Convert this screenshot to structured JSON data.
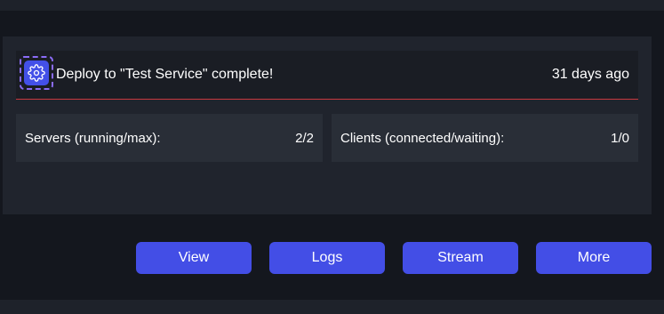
{
  "notification": {
    "message": "Deploy to \"Test Service\" complete!",
    "time": "31 days ago",
    "icon": "gear-icon"
  },
  "stats": {
    "servers": {
      "label": "Servers (running/max):",
      "value": "2/2"
    },
    "clients": {
      "label": "Clients (connected/waiting):",
      "value": "1/0"
    }
  },
  "actions": {
    "view": "View",
    "logs": "Logs",
    "stream": "Stream",
    "more": "More"
  },
  "colors": {
    "accent": "#434ee6",
    "divider": "#c8383f",
    "focus_outline": "#8b6cf6"
  }
}
